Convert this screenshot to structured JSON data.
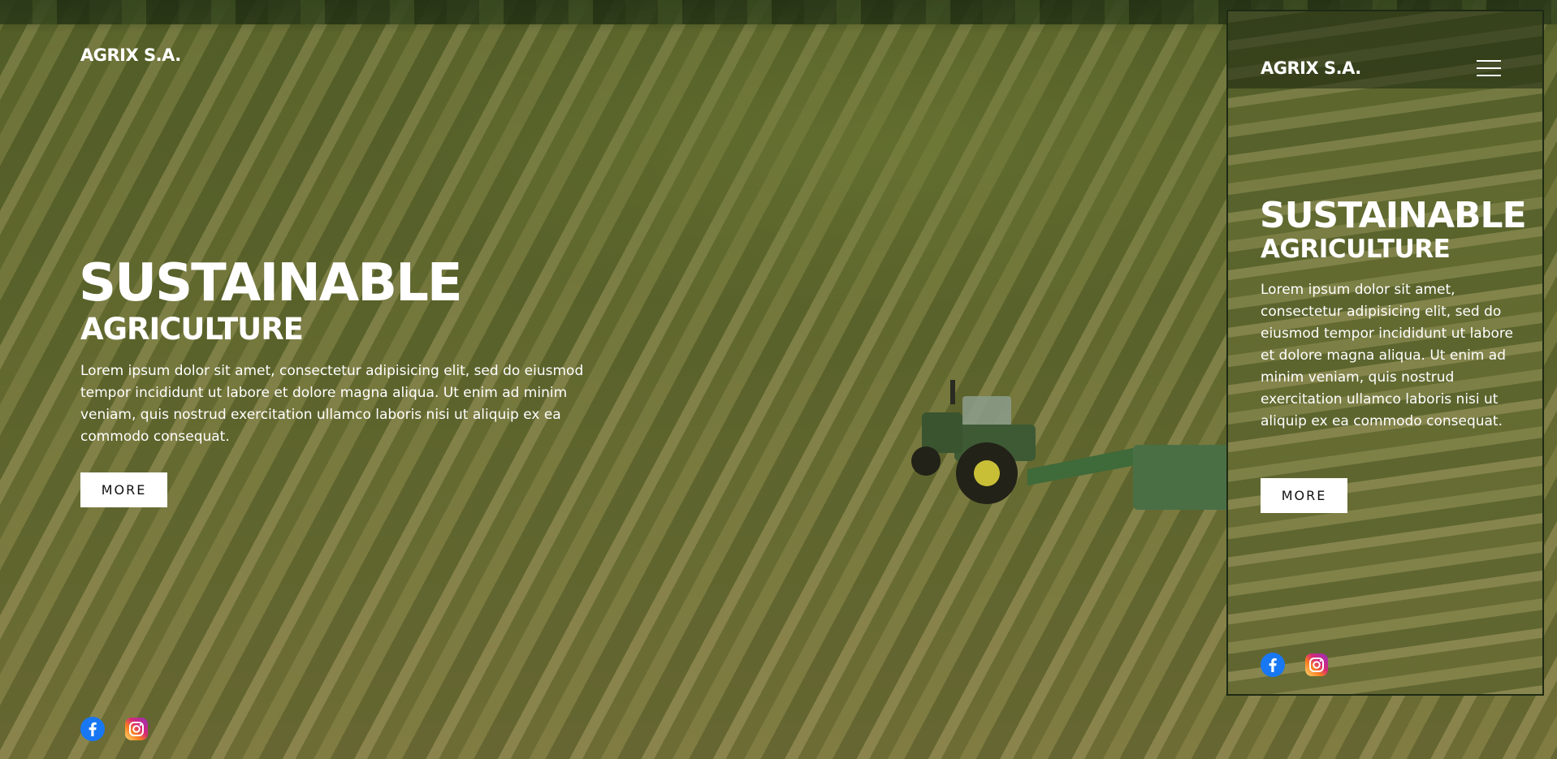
{
  "colors": {
    "text": "#ffffff",
    "button_bg": "#ffffff",
    "button_text": "#111111",
    "facebook": "#1877f2",
    "instagram_start": "#feda75",
    "instagram_end": "#962fbf"
  },
  "desktop": {
    "brand": "AGRIX S.A.",
    "hero": {
      "title": "SUSTAINABLE",
      "subtitle": "AGRICULTURE",
      "text": "Lorem ipsum dolor sit amet, consectetur adipisicing elit, sed do eiusmod tempor incididunt ut labore et dolore magna aliqua. Ut enim ad minim veniam, quis nostrud exercitation ullamco laboris nisi ut aliquip ex ea commodo consequat.",
      "button": "MORE"
    },
    "social": [
      "facebook-icon",
      "instagram-icon"
    ]
  },
  "mobile": {
    "brand": "AGRIX S.A.",
    "menu_icon": "hamburger-menu-icon",
    "hero": {
      "title": "SUSTAINABLE",
      "subtitle": "AGRICULTURE",
      "text": "Lorem ipsum dolor sit amet, consectetur adipisicing elit, sed do eiusmod tempor incididunt ut labore et dolore magna aliqua. Ut enim ad minim veniam, quis nostrud exercitation ullamco laboris nisi ut aliquip ex ea commodo consequat.",
      "button": "MORE"
    },
    "social": [
      "facebook-icon",
      "instagram-icon"
    ]
  }
}
